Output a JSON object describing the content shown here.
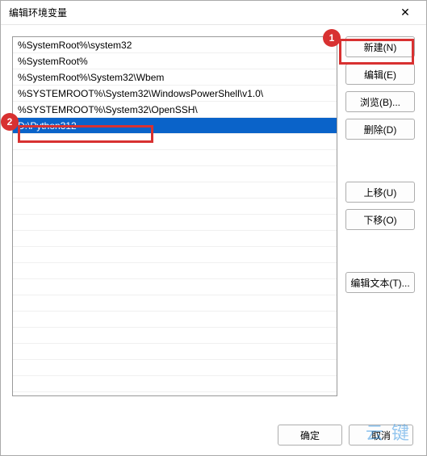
{
  "dialog": {
    "title": "编辑环境变量",
    "close_glyph": "✕"
  },
  "list": {
    "items": [
      "%SystemRoot%\\system32",
      "%SystemRoot%",
      "%SystemRoot%\\System32\\Wbem",
      "%SYSTEMROOT%\\System32\\WindowsPowerShell\\v1.0\\",
      "%SYSTEMROOT%\\System32\\OpenSSH\\",
      "D:\\Python312"
    ],
    "selected_index": 5
  },
  "buttons": {
    "new_": "新建(N)",
    "edit": "编辑(E)",
    "browse": "浏览(B)...",
    "delete_": "删除(D)",
    "moveup": "上移(U)",
    "movedown": "下移(O)",
    "edit_text": "编辑文本(T)...",
    "ok": "确定",
    "cancel": "取消"
  },
  "callouts": {
    "c1": "1",
    "c2": "2"
  },
  "watermark": "云 键"
}
